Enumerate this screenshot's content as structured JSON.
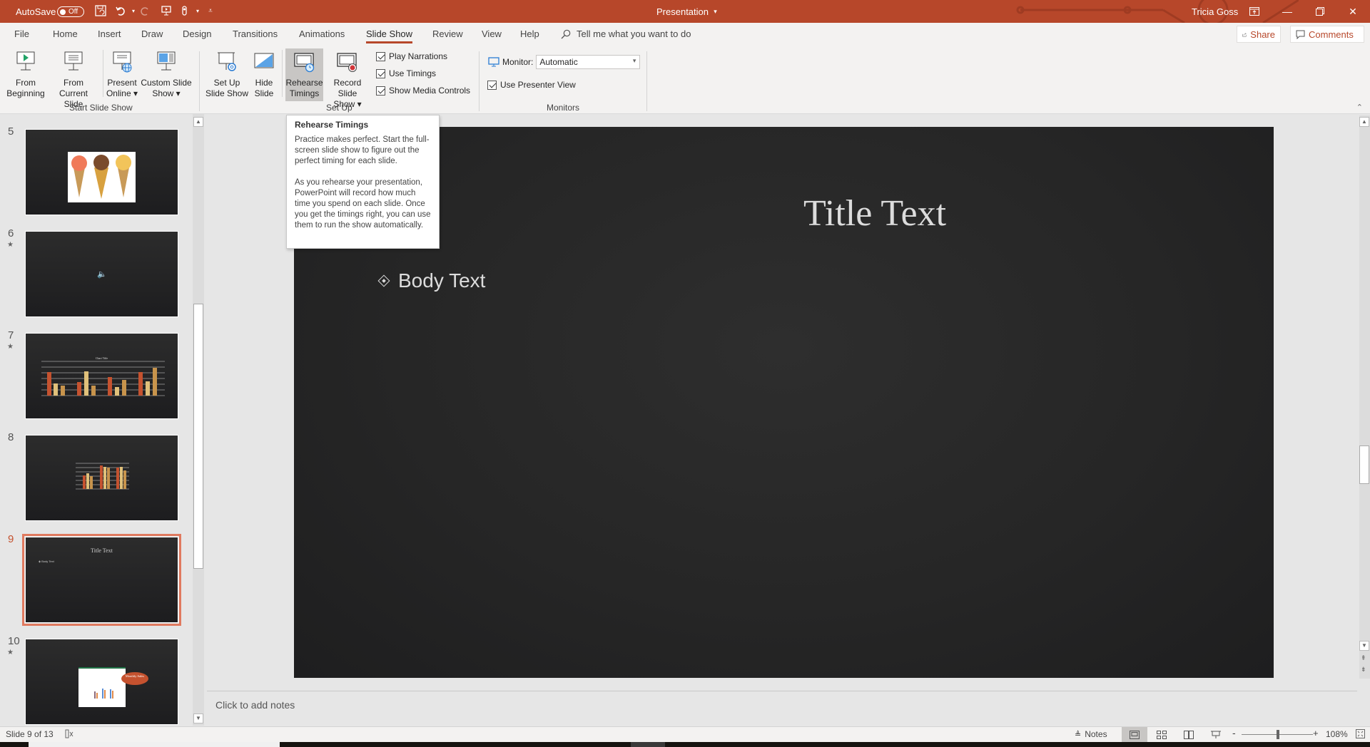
{
  "titlebar": {
    "autosave_label": "AutoSave",
    "autosave_state": "Off",
    "doc_title": "Presentation",
    "doc_title_dropdown": "▾",
    "user_name": "Tricia Goss",
    "qat": [
      "save-icon",
      "undo-icon",
      "redo-icon",
      "start-from-beginning-icon",
      "touch-mode-icon",
      "customize-qat-icon"
    ],
    "window_buttons": [
      "ribbon-display-options",
      "minimize",
      "restore",
      "close"
    ],
    "accent_color": "#b7472a"
  },
  "tabs": [
    {
      "label": "File"
    },
    {
      "label": "Home"
    },
    {
      "label": "Insert"
    },
    {
      "label": "Draw"
    },
    {
      "label": "Design"
    },
    {
      "label": "Transitions"
    },
    {
      "label": "Animations"
    },
    {
      "label": "Slide Show",
      "active": true
    },
    {
      "label": "Review"
    },
    {
      "label": "View"
    },
    {
      "label": "Help"
    }
  ],
  "tell_me": "Tell me what you want to do",
  "share_label": "Share",
  "comments_label": "Comments",
  "ribbon": {
    "groups": [
      {
        "label": "Start Slide Show"
      },
      {
        "label": "Set Up"
      },
      {
        "label": "Monitors"
      }
    ],
    "buttons": {
      "from_beginning": [
        "From",
        "Beginning"
      ],
      "from_current": [
        "From",
        "Current Slide"
      ],
      "present_online": [
        "Present",
        "Online ▾"
      ],
      "custom_show": [
        "Custom Slide",
        "Show ▾"
      ],
      "setup_show": [
        "Set Up",
        "Slide Show"
      ],
      "hide_slide": [
        "Hide",
        "Slide"
      ],
      "rehearse": [
        "Rehearse",
        "Timings"
      ],
      "record": [
        "Record Slide",
        "Show ▾"
      ]
    },
    "checkboxes": [
      {
        "label": "Play Narrations",
        "checked": true
      },
      {
        "label": "Use Timings",
        "checked": true
      },
      {
        "label": "Show Media Controls",
        "checked": true
      }
    ],
    "monitor_label": "Monitor:",
    "monitor_value": "Automatic",
    "presenter_view": {
      "label": "Use Presenter View",
      "checked": true
    }
  },
  "tooltip": {
    "title": "Rehearse Timings",
    "para1": "Practice makes perfect. Start the full-screen slide show to figure out the perfect timing for each slide.",
    "para2": "As you rehearse your presentation, PowerPoint will record how much time you spend on each slide. Once you get the timings right, you can use them to run the show automatically."
  },
  "thumbnails": [
    {
      "number": "5",
      "has_animation": false,
      "content": "ice-cream-cones-image"
    },
    {
      "number": "6",
      "has_animation": true,
      "content": "audio-icon"
    },
    {
      "number": "7",
      "has_animation": true,
      "content": "bar-chart",
      "chart_title": "Chart Title"
    },
    {
      "number": "8",
      "has_animation": false,
      "content": "bar-chart-small"
    },
    {
      "number": "9",
      "has_animation": false,
      "content": "title-body",
      "selected": true,
      "title": "Title Text",
      "body": "Body Text"
    },
    {
      "number": "10",
      "has_animation": true,
      "content": "spreadsheet-callout",
      "callout": "Monthly Sales"
    }
  ],
  "slide": {
    "title": "Title Text",
    "body": "Body Text"
  },
  "notes_placeholder": "Click to add notes",
  "status": {
    "slide_indicator": "Slide 9 of 13",
    "notes_label": "Notes",
    "zoom_minus": "-",
    "zoom_plus": "+",
    "zoom_level": "108%"
  }
}
